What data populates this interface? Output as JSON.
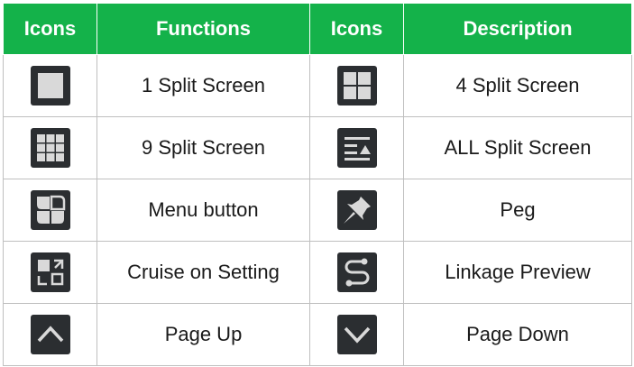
{
  "headers": [
    "Icons",
    "Functions",
    "Icons",
    "Description"
  ],
  "rows": [
    {
      "left_icon": "split-1-icon",
      "left_label": "1 Split Screen",
      "right_icon": "split-4-icon",
      "right_label": "4 Split Screen"
    },
    {
      "left_icon": "split-9-icon",
      "left_label": "9 Split Screen",
      "right_icon": "split-all-icon",
      "right_label": "ALL Split Screen"
    },
    {
      "left_icon": "menu-button-icon",
      "left_label": "Menu button",
      "right_icon": "pushpin-icon",
      "right_label": "Peg"
    },
    {
      "left_icon": "cruise-setting-icon",
      "left_label": "Cruise on Setting",
      "right_icon": "linkage-preview-icon",
      "right_label": "Linkage Preview"
    },
    {
      "left_icon": "chevron-up-icon",
      "left_label": "Page Up",
      "right_icon": "chevron-down-icon",
      "right_label": "Page Down"
    }
  ],
  "colors": {
    "header_bg": "#14b24a",
    "icon_bg": "#2b2e31",
    "icon_fg": "#d9d9d9"
  }
}
